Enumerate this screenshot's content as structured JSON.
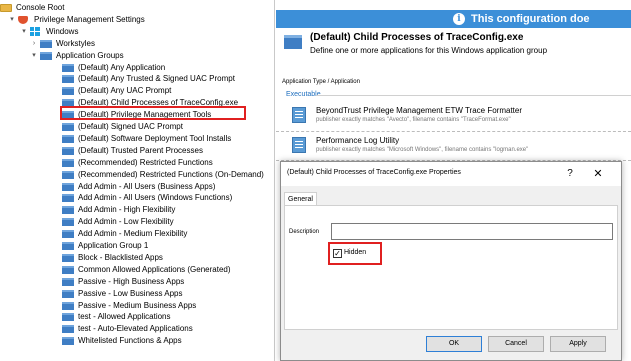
{
  "tree": {
    "nodes": [
      {
        "label": "Console Root",
        "icon": "folder-icon",
        "expander": ""
      },
      {
        "label": "Privilege Management Settings",
        "icon": "shield-icon",
        "expander": "▾"
      },
      {
        "label": "Windows",
        "icon": "windows-icon",
        "expander": "▾"
      },
      {
        "label": "Workstyles",
        "icon": "blue-folder-icon",
        "expander": "›"
      },
      {
        "label": "Application Groups",
        "icon": "blue-folder-icon",
        "expander": "▾"
      },
      {
        "label": "(Default) Any Application",
        "icon": "blue-folder-icon",
        "expander": ""
      },
      {
        "label": "(Default) Any Trusted & Signed UAC Prompt",
        "icon": "blue-folder-icon",
        "expander": ""
      },
      {
        "label": "(Default) Any UAC Prompt",
        "icon": "blue-folder-icon",
        "expander": ""
      },
      {
        "label": "(Default) Child Processes of TraceConfig.exe",
        "icon": "blue-folder-icon",
        "expander": ""
      },
      {
        "label": "(Default) Privilege Management Tools",
        "icon": "blue-folder-icon",
        "expander": ""
      },
      {
        "label": "(Default) Signed UAC Prompt",
        "icon": "blue-folder-icon",
        "expander": ""
      },
      {
        "label": "(Default) Software Deployment Tool Installs",
        "icon": "blue-folder-icon",
        "expander": ""
      },
      {
        "label": "(Default) Trusted Parent Processes",
        "icon": "blue-folder-icon",
        "expander": ""
      },
      {
        "label": "(Recommended) Restricted Functions",
        "icon": "blue-folder-icon",
        "expander": ""
      },
      {
        "label": "(Recommended) Restricted Functions (On-Demand)",
        "icon": "blue-folder-icon",
        "expander": ""
      },
      {
        "label": "Add Admin - All Users (Business Apps)",
        "icon": "blue-folder-icon",
        "expander": ""
      },
      {
        "label": "Add Admin - All Users (Windows Functions)",
        "icon": "blue-folder-icon",
        "expander": ""
      },
      {
        "label": "Add Admin - High Flexibility",
        "icon": "blue-folder-icon",
        "expander": ""
      },
      {
        "label": "Add Admin - Low Flexibility",
        "icon": "blue-folder-icon",
        "expander": ""
      },
      {
        "label": "Add Admin - Medium Flexibility",
        "icon": "blue-folder-icon",
        "expander": ""
      },
      {
        "label": "Application Group 1",
        "icon": "blue-folder-icon",
        "expander": ""
      },
      {
        "label": "Block - Blacklisted Apps",
        "icon": "blue-folder-icon",
        "expander": ""
      },
      {
        "label": "Common Allowed Applications (Generated)",
        "icon": "blue-folder-icon",
        "expander": ""
      },
      {
        "label": "Passive - High Business Apps",
        "icon": "blue-folder-icon",
        "expander": ""
      },
      {
        "label": "Passive - Low Business Apps",
        "icon": "blue-folder-icon",
        "expander": ""
      },
      {
        "label": "Passive - Medium Business Apps",
        "icon": "blue-folder-icon",
        "expander": ""
      },
      {
        "label": "test - Allowed Applications",
        "icon": "blue-folder-icon",
        "expander": ""
      },
      {
        "label": "test - Auto-Elevated Applications",
        "icon": "blue-folder-icon",
        "expander": ""
      },
      {
        "label": "Whitelisted Functions & Apps",
        "icon": "blue-folder-icon",
        "expander": ""
      }
    ]
  },
  "info_bar": {
    "text": "This configuration doe",
    "icon": "info-icon"
  },
  "group": {
    "title": "(Default) Child Processes of TraceConfig.exe",
    "description": "Define one or more applications for this Windows application group"
  },
  "column_header": "Application Type / Application",
  "section_label": "Executable",
  "apps": [
    {
      "name": "BeyondTrust Privilege Management ETW Trace Formatter",
      "match": "publisher exactly matches \"Avecto\", filename contains \"TraceFormat.exe\""
    },
    {
      "name": "Performance Log Utility",
      "match": "publisher exactly matches \"Microsoft Windows\", filename contains \"logman.exe\""
    }
  ],
  "dialog": {
    "title": "(Default) Child Processes of TraceConfig.exe Properties",
    "help": "?",
    "close": "✕",
    "tab": "General",
    "description_label": "Description",
    "description_value": "",
    "hidden_label": "Hidden",
    "hidden_checked": true,
    "hidden_mark": "✓",
    "ok": "OK",
    "cancel": "Cancel",
    "apply": "Apply"
  },
  "colors": {
    "accent": "#3c8fd8",
    "highlight": "#e02020",
    "folder_blue": "#3f7ec4"
  }
}
